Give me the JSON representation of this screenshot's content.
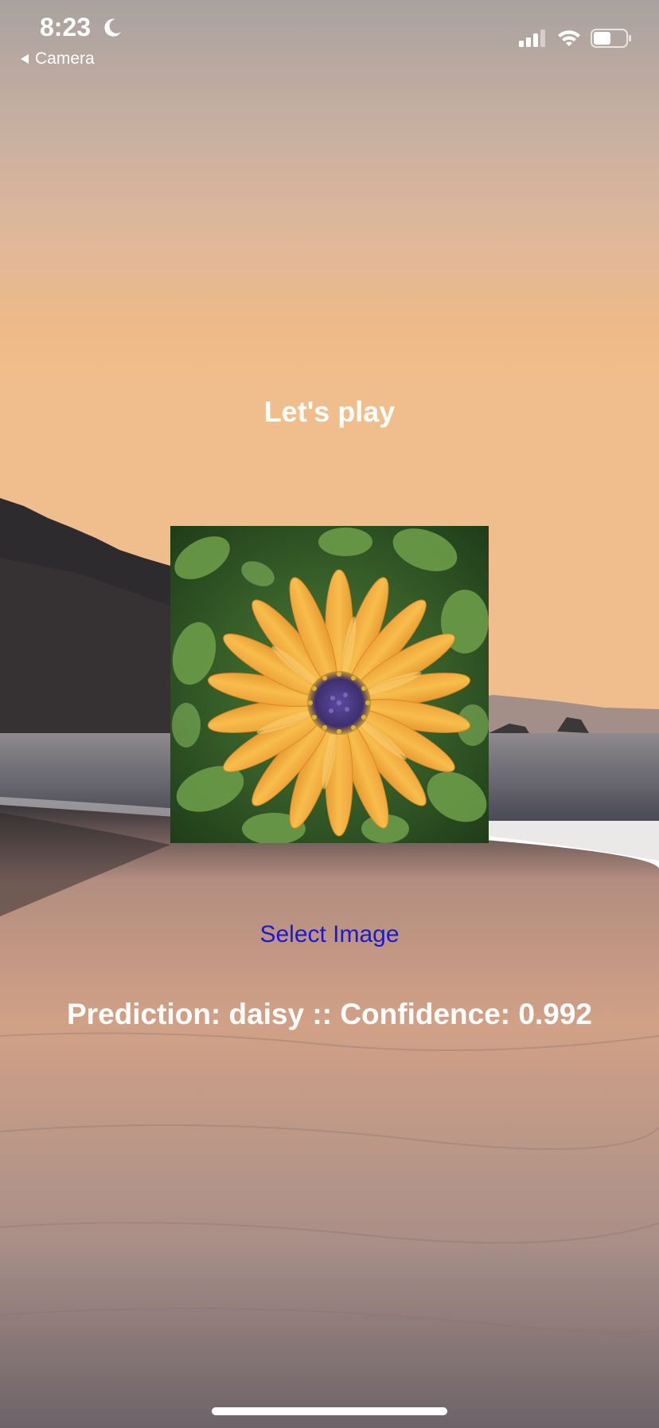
{
  "status_bar": {
    "time": "8:23",
    "back_label": "Camera"
  },
  "main": {
    "title": "Let's play",
    "select_button_label": "Select Image",
    "prediction_text": "Prediction: daisy :: Confidence: 0.992"
  },
  "colors": {
    "select_button": "#1a1ad4",
    "text": "#ffffff"
  },
  "icons": [
    "moon-icon",
    "back-triangle-icon",
    "cellular-signal-icon",
    "wifi-icon",
    "battery-icon"
  ]
}
